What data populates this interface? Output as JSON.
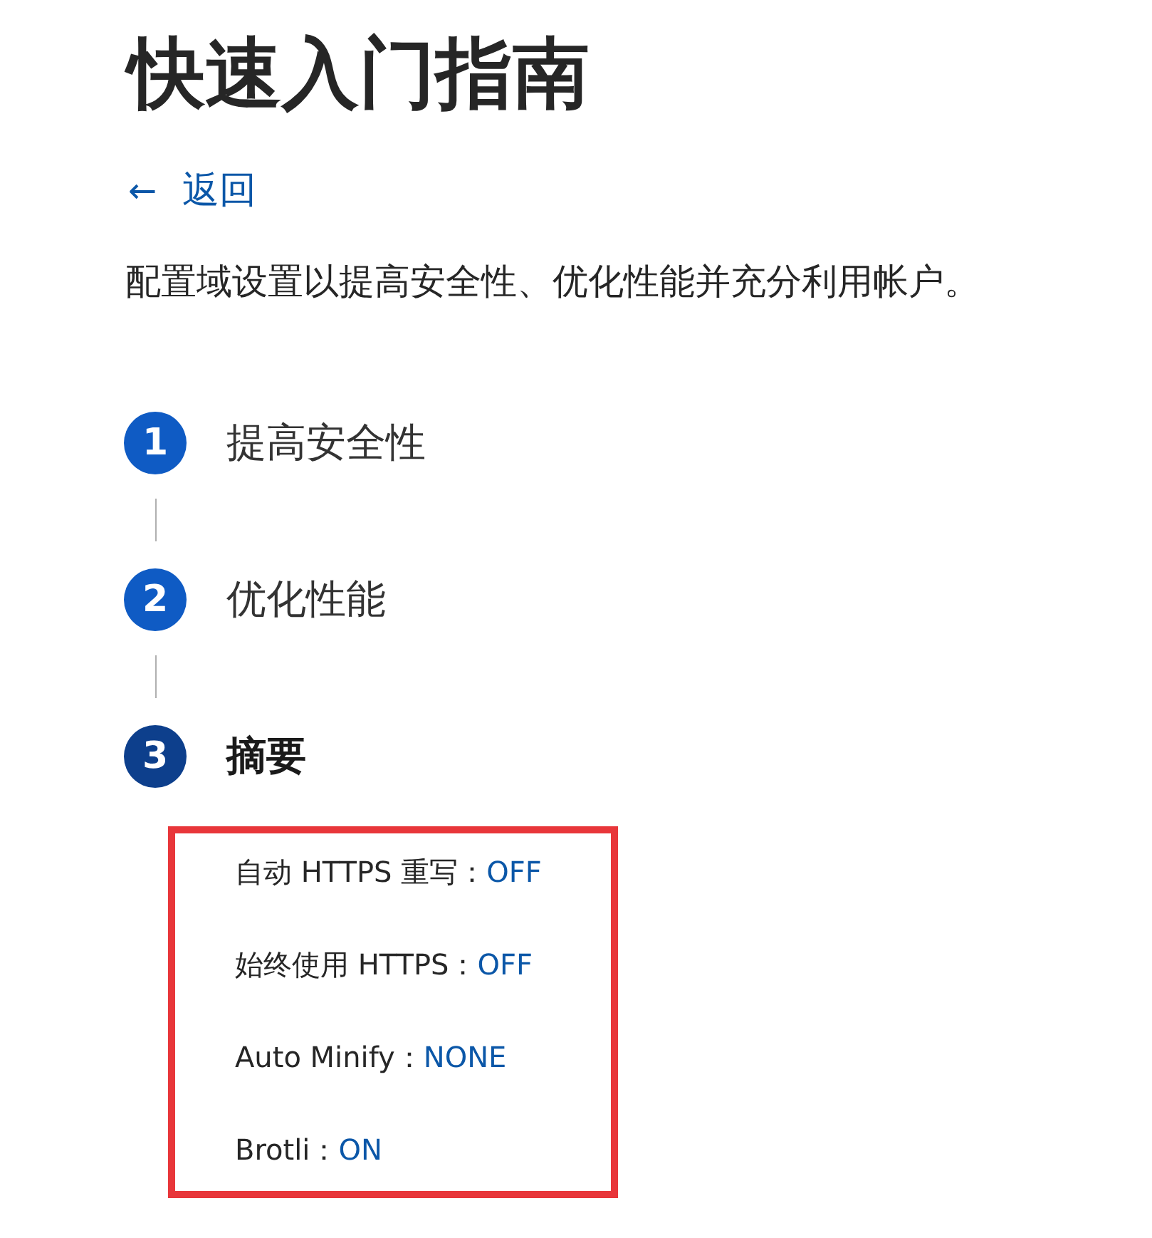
{
  "title": "快速入门指南",
  "back_link": {
    "icon": "←",
    "label": "返回"
  },
  "description": "配置域设置以提高安全性、优化性能并充分利用帐户。",
  "steps": [
    {
      "number": "1",
      "label": "提高安全性",
      "selected": false
    },
    {
      "number": "2",
      "label": "优化性能",
      "selected": false
    },
    {
      "number": "3",
      "label": "摘要",
      "selected": true
    }
  ],
  "summary": {
    "highlighted": true,
    "items": [
      {
        "label": "自动 HTTPS 重写：",
        "value": "OFF"
      },
      {
        "label": "始终使用 HTTPS：",
        "value": "OFF"
      },
      {
        "label": "Auto Minify：",
        "value": "NONE"
      },
      {
        "label": "Brotli：",
        "value": "ON"
      }
    ]
  }
}
